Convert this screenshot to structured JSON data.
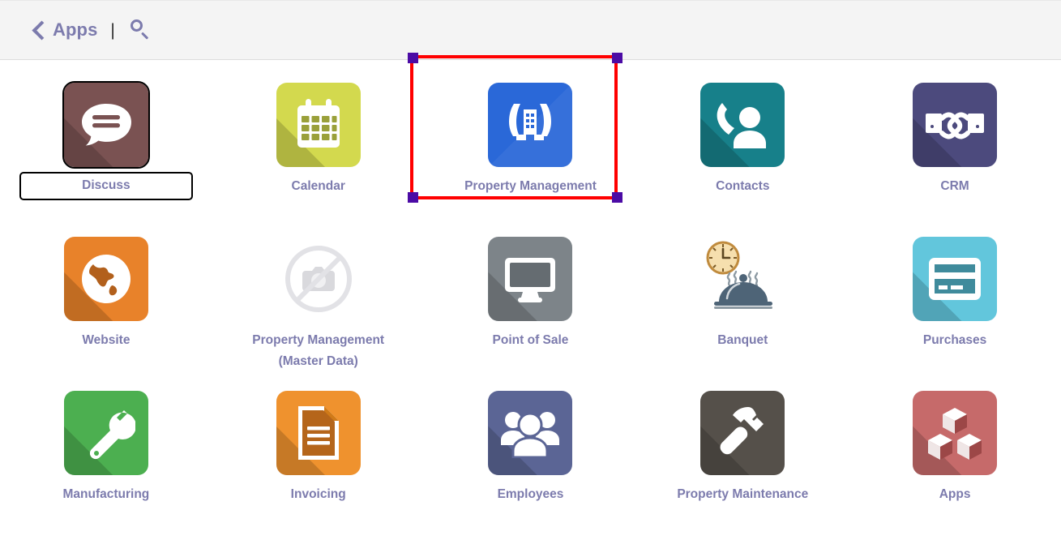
{
  "header": {
    "back_icon": "chevron-left-icon",
    "apps_label": "Apps",
    "separator": "|",
    "search_icon": "search-icon"
  },
  "colors": {
    "accent_text": "#7c7bad",
    "header_bg": "#f4f4f4",
    "page_bg": "#ffffff",
    "selection_border": "#ff0000",
    "selection_handle": "#4b0ba5",
    "focus_border": "#000000"
  },
  "selection": {
    "target_app": "Property Management",
    "handle_count": 4
  },
  "grid": {
    "columns": 5,
    "apps": [
      {
        "label": "Discuss",
        "icon": "chat-bubble-icon",
        "bg": "#7a5252",
        "state": "focused"
      },
      {
        "label": "Calendar",
        "icon": "calendar-icon",
        "bg": "#d3d94e",
        "state": "normal"
      },
      {
        "label": "Property Management",
        "icon": "hands-building-icon",
        "bg": "#2a68d8",
        "state": "selected"
      },
      {
        "label": "Contacts",
        "icon": "phone-person-icon",
        "bg": "#17808a",
        "state": "normal"
      },
      {
        "label": "CRM",
        "icon": "handshake-icon",
        "bg": "#4c4a7d",
        "state": "normal"
      },
      {
        "label": "Website",
        "icon": "globe-icon",
        "bg": "#e8822a",
        "state": "normal"
      },
      {
        "label": "Property Management\n(Master Data)",
        "icon": "broken-image-icon",
        "bg": "transparent",
        "state": "broken"
      },
      {
        "label": "Point of Sale",
        "icon": "monitor-icon",
        "bg": "#7d8489",
        "state": "normal"
      },
      {
        "label": "Banquet",
        "icon": "clock-cloche-icon",
        "bg": "transparent",
        "state": "normal"
      },
      {
        "label": "Purchases",
        "icon": "credit-card-icon",
        "bg": "#62c6dc",
        "state": "normal"
      },
      {
        "label": "Manufacturing",
        "icon": "wrench-icon",
        "bg": "#4caf50",
        "state": "normal"
      },
      {
        "label": "Invoicing",
        "icon": "document-lines-icon",
        "bg": "#ef922e",
        "state": "normal"
      },
      {
        "label": "Employees",
        "icon": "people-group-icon",
        "bg": "#5b6595",
        "state": "normal"
      },
      {
        "label": "Property Maintenance",
        "icon": "hammer-icon",
        "bg": "#55504a",
        "state": "normal"
      },
      {
        "label": "Apps",
        "icon": "cubes-icon",
        "bg": "#c66a6a",
        "state": "normal"
      }
    ]
  }
}
